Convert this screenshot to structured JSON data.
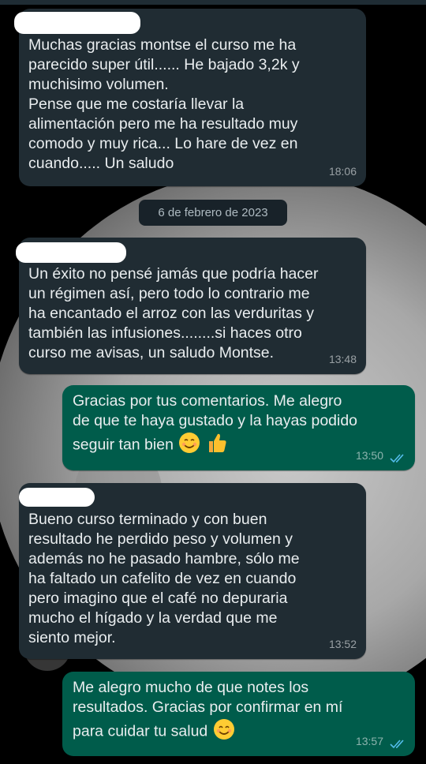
{
  "messages": [
    {
      "text": "Muchas gracias montse el curso me ha\nparecido super  útil...... He bajado 3,2k y\nmuchisimo volumen.\nPense que me costaría llevar la\nalimentación pero me ha resultado muy\ncomodo y muy rica... Lo hare de vez en\ncuando..... Un saludo",
      "time": "18:06"
    },
    {
      "text": "Un éxito no pensé jamás que podría hacer\nun régimen así, pero todo lo contrario me\nha encantado el arroz con las verduritas y\ntambién las infusiones........si haces otro\ncurso me avisas, un saludo Montse.",
      "time": "13:48"
    },
    {
      "text": "Gracias por tus comentarios. Me alegro\nde que te haya gustado y la hayas podido\nseguir tan bien",
      "time": "13:50"
    },
    {
      "text": "Bueno curso terminado y con buen\nresultado he perdido peso y volumen y\nademás no he pasado hambre, sólo me\nha faltado un cafelito de vez en cuando\npero imagino que el café no depuraria\nmucho el hígado y la verdad que me\nsiento mejor.",
      "time": "13:52"
    },
    {
      "text": "Me alegro mucho de que notes los\nresultados. Gracias por confirmar en mí\npara cuidar tu salud",
      "time": "13:57"
    }
  ],
  "date_separator": "6 de febrero de 2023",
  "colors": {
    "incoming_bubble": "#202c33",
    "outgoing_bubble": "#005c4b",
    "read_ticks": "#53bdeb"
  }
}
